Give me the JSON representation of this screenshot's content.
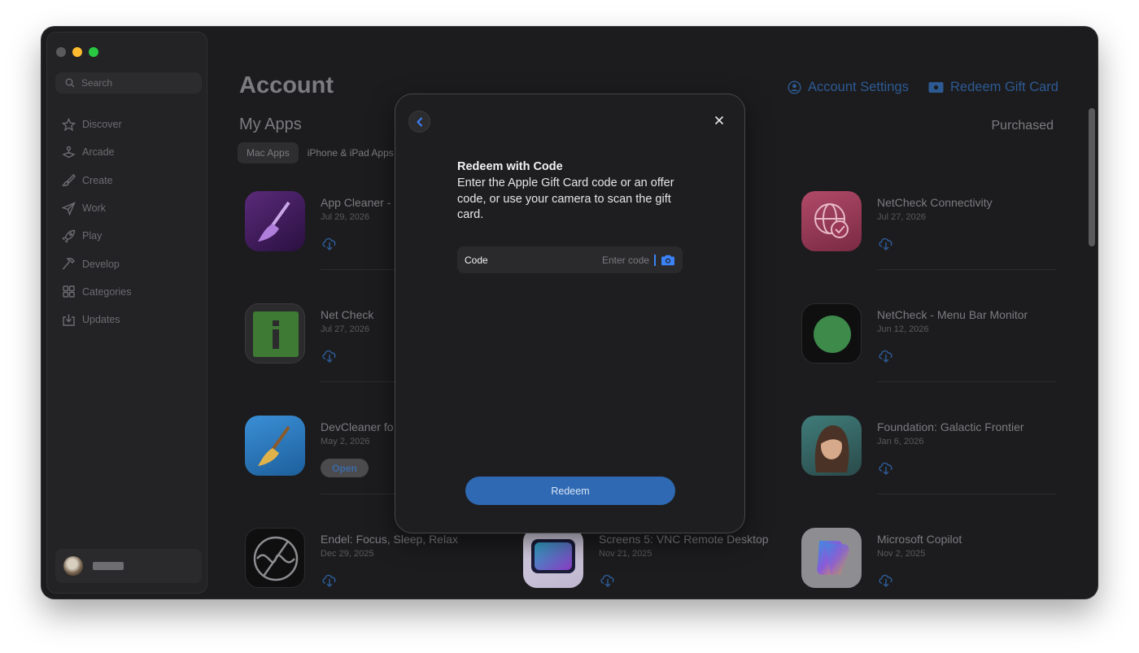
{
  "sidebar": {
    "search_placeholder": "Search",
    "items": [
      {
        "label": "Discover",
        "icon": "star-icon"
      },
      {
        "label": "Arcade",
        "icon": "joystick-icon"
      },
      {
        "label": "Create",
        "icon": "brush-icon"
      },
      {
        "label": "Work",
        "icon": "paper-plane-icon"
      },
      {
        "label": "Play",
        "icon": "rocket-icon"
      },
      {
        "label": "Develop",
        "icon": "hammer-icon"
      },
      {
        "label": "Categories",
        "icon": "grid-icon"
      },
      {
        "label": "Updates",
        "icon": "download-tray-icon"
      }
    ]
  },
  "header": {
    "title": "Account",
    "account_settings": "Account Settings",
    "redeem_gift_card": "Redeem Gift Card",
    "subtitle": "My Apps",
    "purchased": "Purchased",
    "tabs": [
      "Mac Apps",
      "iPhone & iPad Apps"
    ]
  },
  "apps": [
    {
      "name": "App Cleaner -",
      "date": "Jul 29, 2026",
      "action": "download"
    },
    {
      "name": "NetCheck Connectivity",
      "date": "Jul 27, 2026",
      "action": "download"
    },
    {
      "name": "Net Check",
      "date": "Jul 27, 2026",
      "action": "download"
    },
    {
      "name": "NetCheck - Menu Bar Monitor",
      "date": "Jun 12, 2026",
      "action": "download"
    },
    {
      "name": "DevCleaner fo",
      "date": "May 2, 2026",
      "action": "Open"
    },
    {
      "name": "Foundation: Galactic Frontier",
      "date": "Jan 6, 2026",
      "action": "download"
    },
    {
      "name": "Endel: Focus, Sleep, Relax",
      "date": "Dec 29, 2025",
      "action": "download"
    },
    {
      "name": "Screens 5: VNC Remote Desktop",
      "date": "Nov 21, 2025",
      "action": "download"
    },
    {
      "name": "Microsoft Copilot",
      "date": "Nov 2, 2025",
      "action": "download"
    }
  ],
  "modal": {
    "title": "Redeem with Code",
    "description": "Enter the Apple Gift Card code or an offer code, or use your camera to scan the gift card.",
    "code_label": "Code",
    "code_placeholder": "Enter code",
    "redeem_button": "Redeem"
  },
  "colors": {
    "accent": "#2f69b3",
    "window_bg": "#1c1c1e",
    "modal_bg": "#1e1e20"
  }
}
